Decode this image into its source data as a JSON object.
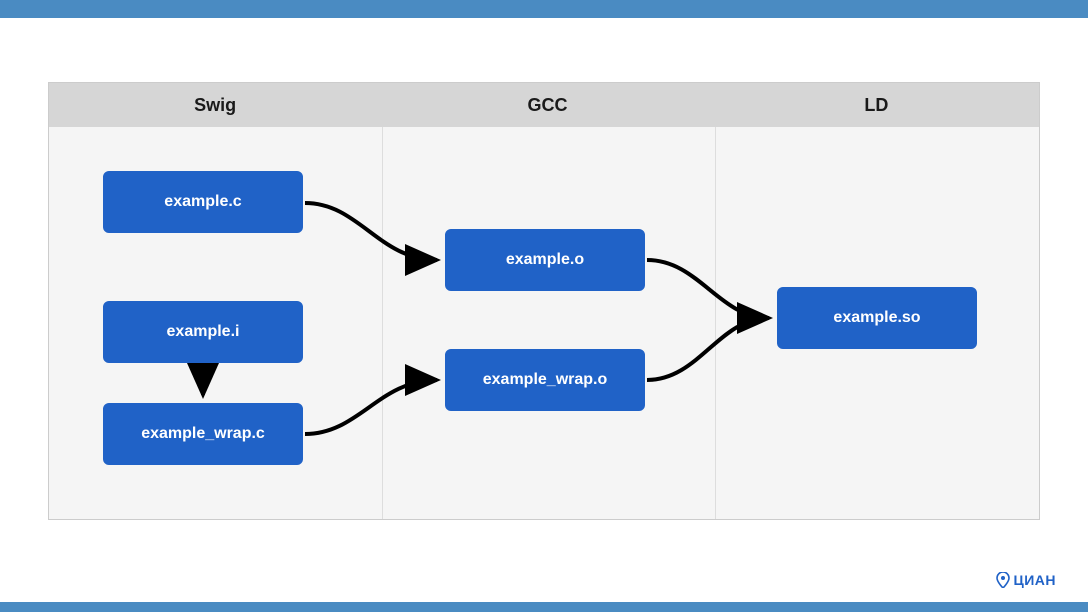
{
  "columns": {
    "swig": "Swig",
    "gcc": "GCC",
    "ld": "LD"
  },
  "nodes": {
    "example_c": "example.c",
    "example_i": "example.i",
    "example_wrap_c": "example_wrap.c",
    "example_o": "example.o",
    "example_wrap_o": "example_wrap.o",
    "example_so": "example.so"
  },
  "logo": "ЦИАН"
}
